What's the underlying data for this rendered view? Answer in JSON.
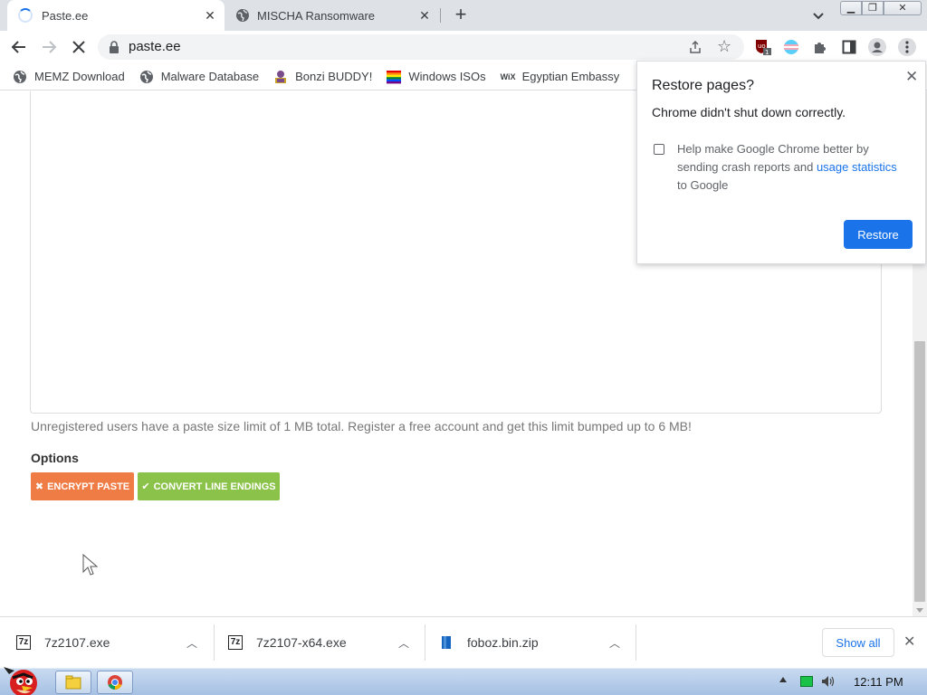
{
  "tabs": [
    {
      "title": "Paste.ee",
      "active": true,
      "icon": "loading-spinner"
    },
    {
      "title": "MISCHA Ransomware",
      "active": false,
      "icon": "globe-icon"
    }
  ],
  "toolbar": {
    "url": "paste.ee",
    "extension_badge": "1"
  },
  "bookmarks": [
    {
      "label": "MEMZ Download",
      "icon": "globe-icon"
    },
    {
      "label": "Malware Database",
      "icon": "globe-icon"
    },
    {
      "label": "Bonzi BUDDY!",
      "icon": "bonzi-icon"
    },
    {
      "label": "Windows ISOs",
      "icon": "rainbow-flag-icon"
    },
    {
      "label": "Egyptian Embassy",
      "icon": "wix-icon",
      "icon_text": "WiX"
    }
  ],
  "page": {
    "limit_note": "Unregistered users have a paste size limit of 1 MB total. Register a free account and get this limit bumped up to 6 MB!",
    "options_label": "Options",
    "encrypt_label": "ENCRYPT PASTE",
    "convert_label": "CONVERT LINE ENDINGS",
    "colors": {
      "encrypt": "#f07c45",
      "convert": "#8bc34a"
    }
  },
  "popup": {
    "title": "Restore pages?",
    "subtitle": "Chrome didn't shut down correctly.",
    "crash_text_before": "Help make Google Chrome better by sending crash reports and ",
    "crash_link": "usage statistics",
    "crash_text_after": " to Google",
    "restore_label": "Restore",
    "checked": false,
    "accent": "#1a73e8"
  },
  "downloads": [
    {
      "filename": "7z2107.exe",
      "icon": "7zip-icon",
      "icon_text": "7z"
    },
    {
      "filename": "7z2107-x64.exe",
      "icon": "7zip-icon",
      "icon_text": "7z"
    },
    {
      "filename": "foboz.bin.zip",
      "icon": "zip-file-icon"
    }
  ],
  "shelf": {
    "show_all_label": "Show all"
  },
  "taskbar": {
    "time": "12:11 PM"
  }
}
